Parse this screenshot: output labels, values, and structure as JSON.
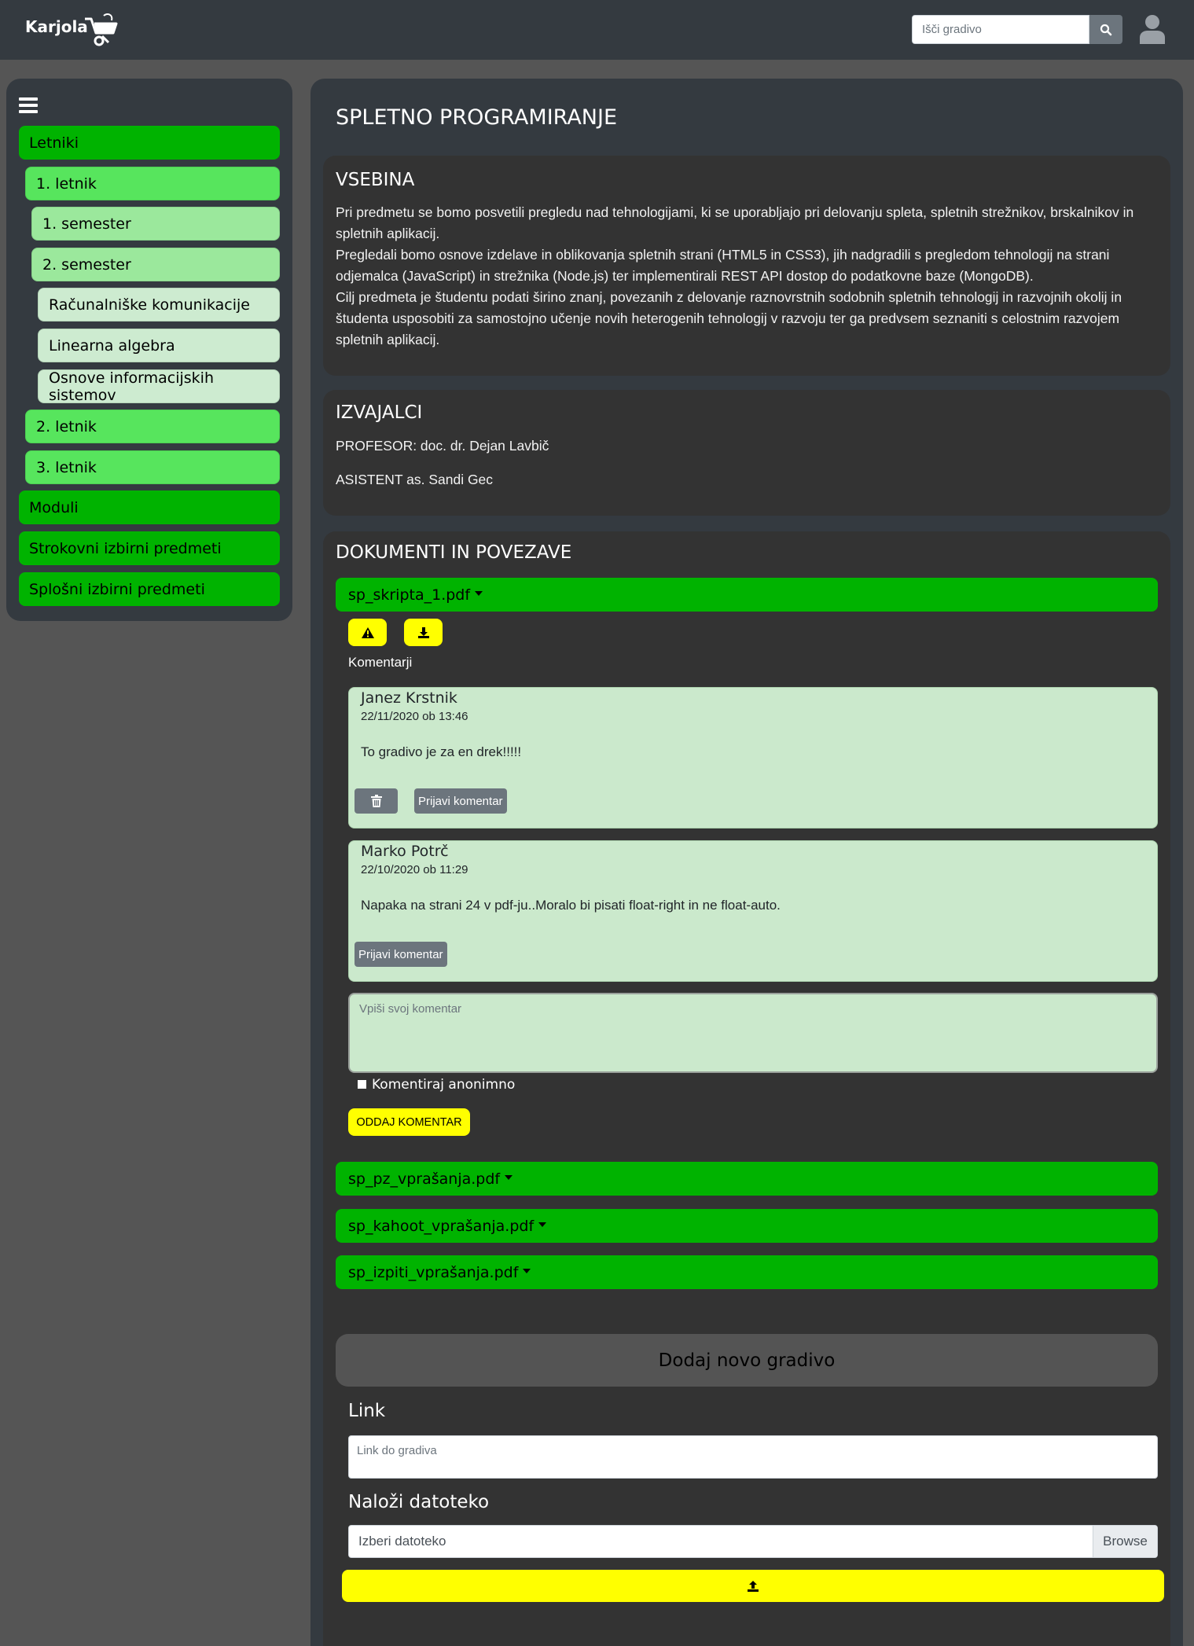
{
  "header": {
    "brand": "Karjola",
    "search_placeholder": "Išči gradivo"
  },
  "sidebar": {
    "items": [
      {
        "label": "Letniki"
      },
      {
        "label": "1. letnik"
      },
      {
        "label": "1. semester"
      },
      {
        "label": "2. semester"
      },
      {
        "label": "Računalniške komunikacije"
      },
      {
        "label": "Linearna algebra"
      },
      {
        "label": "Osnove informacijskih sistemov"
      },
      {
        "label": "2. letnik"
      },
      {
        "label": "3. letnik"
      },
      {
        "label": "Moduli"
      },
      {
        "label": "Strokovni izbirni predmeti"
      },
      {
        "label": "Splošni izbirni predmeti"
      }
    ]
  },
  "page": {
    "title": "SPLETNO PROGRAMIRANJE"
  },
  "content": {
    "title": "VSEBINA",
    "paragraphs": [
      "Pri predmetu se bomo posvetili pregledu nad tehnologijami, ki se uporabljajo pri delovanju spleta, spletnih strežnikov, brskalnikov in spletnih aplikacij.",
      "Pregledali bomo osnove izdelave in oblikovanja spletnih strani (HTML5 in CSS3), jih nadgradili s pregledom tehnologij na strani odjemalca (JavaScript) in strežnika (Node.js) ter implementirali REST API dostop do podatkovne baze (MongoDB).",
      "Cilj predmeta je študentu podati širino znanj, povezanih z delovanje raznovrstnih sodobnih spletnih tehnologij in razvojnih okolij in študenta usposobiti za samostojno učenje novih heterogenih tehnologij v razvoju ter ga predvsem seznaniti s celostnim razvojem spletnih aplikacij."
    ]
  },
  "lecturers": {
    "title": "IZVAJALCI",
    "professor": "PROFESOR: doc. dr. Dejan Lavbič",
    "assistant": "ASISTENT as. Sandi Gec"
  },
  "documents": {
    "title": "DOKUMENTI IN POVEZAVE",
    "files": [
      {
        "name": "sp_skripta_1.pdf"
      },
      {
        "name": "sp_pz_vprašanja.pdf"
      },
      {
        "name": "sp_kahoot_vprašanja.pdf"
      },
      {
        "name": "sp_izpiti_vprašanja.pdf"
      }
    ],
    "comments_label": "Komentarji",
    "comments": [
      {
        "author": "Janez Krstnik",
        "date": "22/11/2020 ob 13:46",
        "text": "To gradivo je za en drek!!!!!",
        "report_label": "Prijavi komentar"
      },
      {
        "author": "Marko Potrč",
        "date": "22/10/2020 ob 11:29",
        "text": "Napaka na strani 24 v pdf-ju..Moralo bi pisati float-right in ne float-auto.",
        "report_label": "Prijavi komentar"
      }
    ],
    "comment_placeholder": "Vpiši svoj komentar",
    "anonymous_label": "Komentiraj anonimno",
    "submit_label": "ODDAJ KOMENTAR"
  },
  "add_material": {
    "title": "Dodaj novo gradivo",
    "link_label": "Link",
    "link_placeholder": "Link do gradiva",
    "upload_label": "Naloži datoteko",
    "file_placeholder": "Izberi datoteko",
    "browse_label": "Browse"
  },
  "colors": {
    "accent_green": "#00b300",
    "accent_yellow": "#ffff00",
    "panel": "#343a40",
    "comment_bg": "#cbe9cc"
  }
}
